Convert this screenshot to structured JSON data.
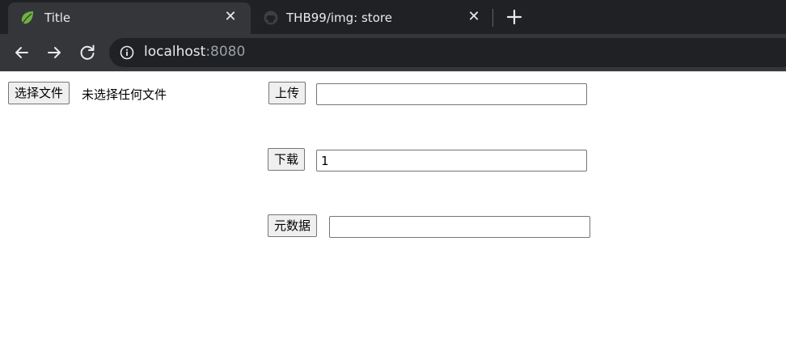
{
  "browser": {
    "tabs": [
      {
        "title": "Title",
        "active": true,
        "icon": "spring-leaf-icon"
      },
      {
        "title": "THB99/img: store",
        "active": false,
        "icon": "github-icon"
      }
    ],
    "close_glyph": "✕",
    "url_host": "localhost",
    "url_port": ":8080"
  },
  "form": {
    "choose_file_label": "选择文件",
    "no_file_text": "未选择任何文件",
    "upload_label": "上传",
    "upload_value": "",
    "download_label": "下载",
    "download_value": "1",
    "metadata_label": "元数据",
    "metadata_value": ""
  },
  "colors": {
    "tabstrip": "#202124",
    "tab_active": "#35363a",
    "text_light": "#e8eaed",
    "spring_green": "#6db33f"
  }
}
